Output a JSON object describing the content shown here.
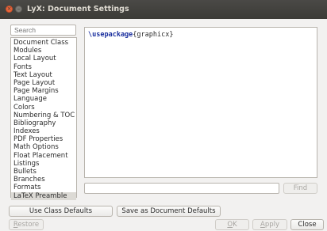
{
  "window": {
    "title": "LyX: Document Settings",
    "close_glyph": "×",
    "minimize_glyph": "–"
  },
  "sidebar": {
    "search_placeholder": "Search",
    "items": [
      {
        "label": "Document Class"
      },
      {
        "label": "Modules"
      },
      {
        "label": "Local Layout"
      },
      {
        "label": "Fonts"
      },
      {
        "label": "Text Layout"
      },
      {
        "label": "Page Layout"
      },
      {
        "label": "Page Margins"
      },
      {
        "label": "Language"
      },
      {
        "label": "Colors"
      },
      {
        "label": "Numbering & TOC"
      },
      {
        "label": "Bibliography"
      },
      {
        "label": "Indexes"
      },
      {
        "label": "PDF Properties"
      },
      {
        "label": "Math Options"
      },
      {
        "label": "Float Placement"
      },
      {
        "label": "Listings"
      },
      {
        "label": "Bullets"
      },
      {
        "label": "Branches"
      },
      {
        "label": "Formats"
      },
      {
        "label": "LaTeX Preamble"
      }
    ],
    "selected_index": 19
  },
  "editor": {
    "command": "\\usepackage",
    "argument": "{graphicx}"
  },
  "find": {
    "value": "",
    "button_label": "Find"
  },
  "buttons": {
    "use_class_defaults": "Use Class Defaults",
    "save_as_document_defaults": "Save as Document Defaults",
    "restore_first": "R",
    "restore_rest": "estore",
    "ok_first": "O",
    "ok_rest": "K",
    "apply_first": "A",
    "apply_rest": "pply",
    "close": "Close"
  }
}
